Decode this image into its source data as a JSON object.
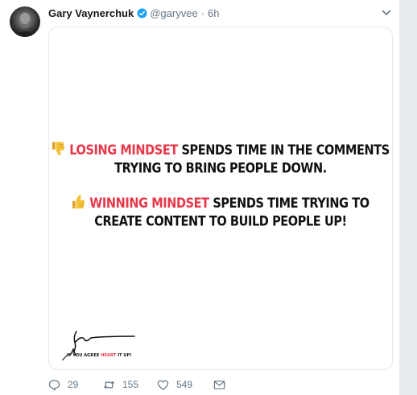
{
  "tweet": {
    "author": {
      "name": "Gary Vaynerchuk",
      "handle": "@garyvee",
      "separator": "·",
      "time": "6h",
      "verified": true
    },
    "media": {
      "block1": {
        "emoji": "thumbs-down",
        "highlight": "LOSING MINDSET",
        "rest_line1": " SPENDS TIME IN THE COMMENTS",
        "line2": "TRYING TO BRING PEOPLE DOWN."
      },
      "block2": {
        "emoji": "thumbs-up",
        "highlight": "WINNING MINDSET",
        "rest_line1": " SPENDS TIME TRYING TO",
        "line2": "CREATE CONTENT TO BUILD PEOPLE UP!"
      },
      "signature_caption": {
        "before": "IF YOU AGREE ",
        "highlight": "HEART",
        "after": " IT UP!"
      }
    },
    "actions": {
      "replies": "29",
      "retweets": "155",
      "likes": "549"
    }
  },
  "colors": {
    "highlight": "#e8374a",
    "verified": "#1da1f2",
    "muted": "#657786",
    "border": "#e1e8ed",
    "scrollbar": "#e6ecf0"
  }
}
